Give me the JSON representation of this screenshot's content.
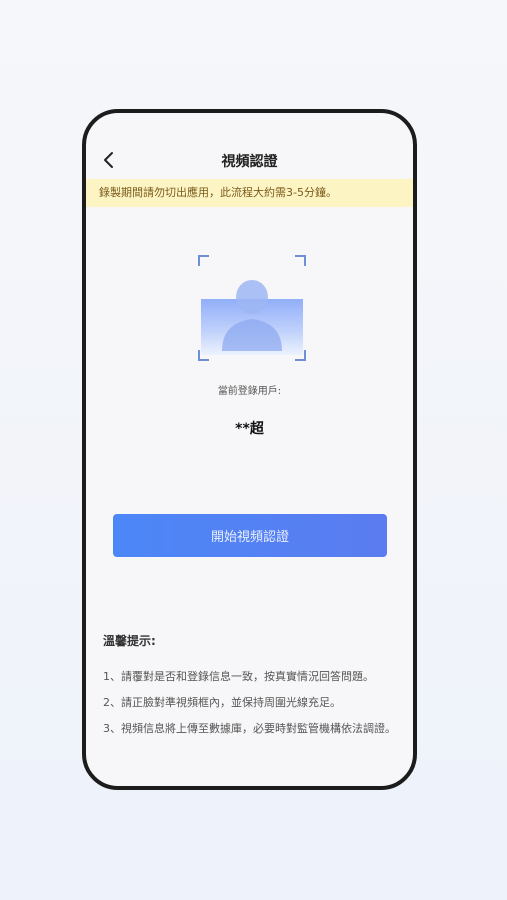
{
  "header": {
    "back_icon": "chevron-left-icon",
    "title": "視頻認證"
  },
  "notice": {
    "text": "錄製期間請勿切出應用，此流程大約需3-5分鐘。",
    "background": "#fdf4c4"
  },
  "face_frame": {
    "icon": "user-silhouette-icon"
  },
  "user": {
    "label": "當前登錄用戶:",
    "name": "**超"
  },
  "start_button": {
    "label": "開始視頻認證",
    "color": "#4c87f7"
  },
  "tips": {
    "title": "溫馨提示:",
    "items": [
      "1、請覆對是否和登錄信息一致，按真實情況回答問題。",
      "2、請正臉對準視頻框內，並保持周圍光線充足。",
      "3、視頻信息將上傳至數據庫，必要時對監管機構依法調證。"
    ]
  }
}
